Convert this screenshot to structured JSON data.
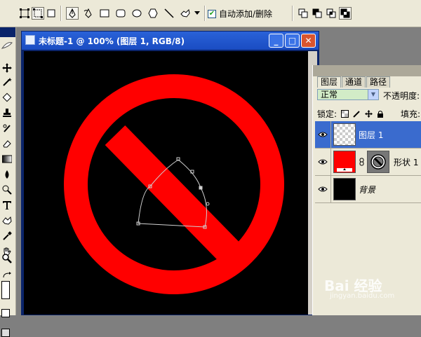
{
  "options_bar": {
    "auto_add_delete_checked": true,
    "auto_add_delete_check_glyph": "✔",
    "auto_add_delete_label": "自动添加/删除",
    "icons": [
      "shape-layer-icon",
      "paths-icon",
      "fill-pixels-icon",
      "pen-icon",
      "freeform-pen-icon",
      "rectangle-icon",
      "rounded-rectangle-icon",
      "ellipse-icon",
      "polygon-icon",
      "line-icon",
      "custom-shape-icon",
      "dropdown-arrow-icon",
      "add-to-area-icon",
      "subtract-area-icon",
      "intersect-area-icon",
      "exclude-overlap-icon"
    ]
  },
  "document": {
    "title": "未标题-1 @ 100% (图层 1, RGB/8)",
    "minimize_glyph": "_",
    "maximize_glyph": "□",
    "close_glyph": "✕",
    "colors": {
      "canvas": "#000000",
      "ring": "#ff0000",
      "path": "#cccccc"
    }
  },
  "layers_panel": {
    "tabs": [
      {
        "label": "图层",
        "active": true
      },
      {
        "label": "通道",
        "active": false
      },
      {
        "label": "路径",
        "active": false
      }
    ],
    "blend_mode": "正常",
    "dropdown_glyph": "▼",
    "opacity_label": "不透明度:",
    "lock_label": "锁定:",
    "fill_label": "填充:",
    "layers": [
      {
        "name": "图层 1",
        "thumb": "transparent",
        "selected": true,
        "visible": true
      },
      {
        "name": "形状 1",
        "thumb": "red",
        "selected": false,
        "visible": true,
        "has_vector_mask": true
      },
      {
        "name": "背景",
        "thumb": "black",
        "selected": false,
        "visible": true,
        "italic": true
      }
    ]
  },
  "watermark": {
    "brand": "Bai 经验",
    "url": "jingyan.baidu.com"
  }
}
